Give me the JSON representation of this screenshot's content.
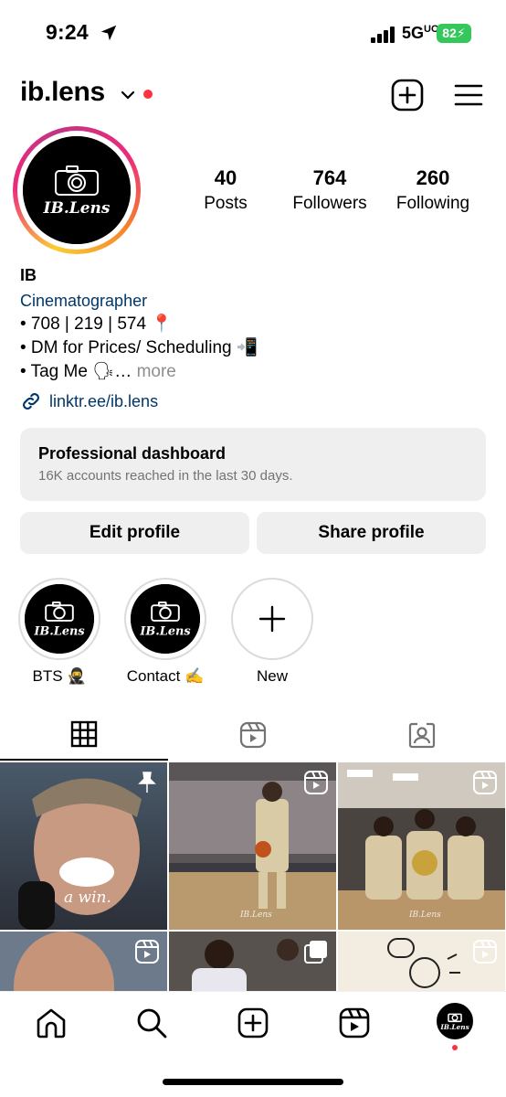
{
  "status_bar": {
    "time": "9:24",
    "network": "5G",
    "network_sup": "UC",
    "battery": "82",
    "battery_color": "#34c759"
  },
  "header": {
    "username": "ib.lens"
  },
  "profile": {
    "avatar_logo_text": "IB.Lens",
    "stats": [
      {
        "value": "40",
        "label": "Posts"
      },
      {
        "value": "764",
        "label": "Followers"
      },
      {
        "value": "260",
        "label": "Following"
      }
    ],
    "name": "IB",
    "category": "Cinematographer",
    "bio_lines": [
      "• 708 | 219 | 574 📍",
      "• DM for Prices/ Scheduling 📲",
      "• Tag Me 🗣…"
    ],
    "bio_more": "more",
    "link": "linktr.ee/ib.lens"
  },
  "dashboard": {
    "title": "Professional dashboard",
    "subtitle": "16K accounts reached in the last 30 days."
  },
  "buttons": {
    "edit": "Edit profile",
    "share": "Share profile"
  },
  "highlights": [
    {
      "label": "BTS 🥷"
    },
    {
      "label": "Contact ✍️"
    },
    {
      "label": "New"
    }
  ],
  "grid": {
    "tile1_caption": "a win.",
    "watermark": "IB.Lens"
  },
  "colors": {
    "link": "#00376b",
    "accent_red": "#ff3040"
  }
}
